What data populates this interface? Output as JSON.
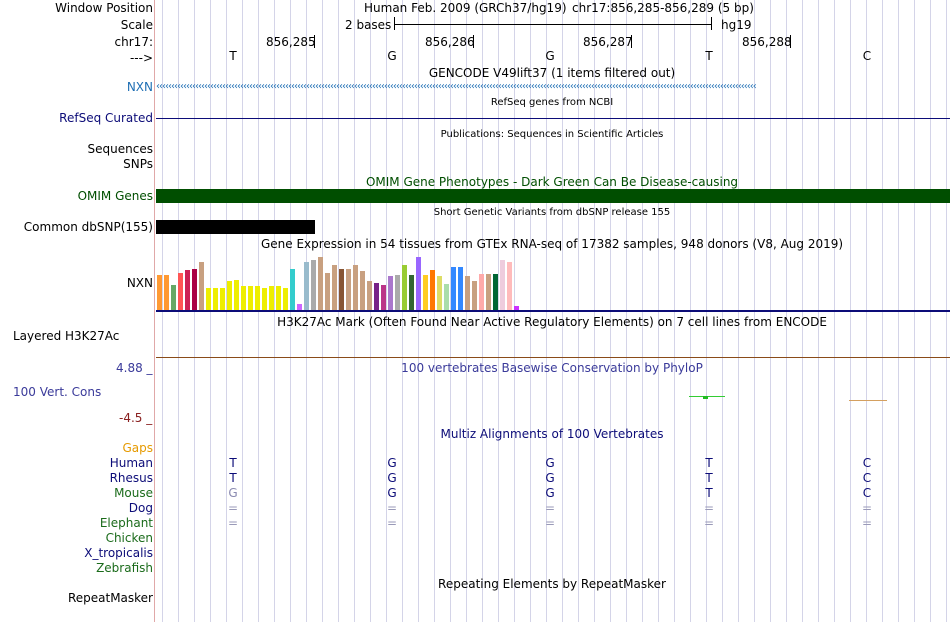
{
  "header": {
    "window_position_label": "Window Position",
    "scale_label": "Scale",
    "chr_label": "chr17:",
    "strand_label": "--->",
    "assembly_text": "Human Feb. 2009 (GRCh37/hg19)",
    "position_text": "chr17:856,285-856,289 (5 bp)",
    "scale_text": "2 bases",
    "db_text": "hg19",
    "coordinates": [
      "856,285",
      "856,286",
      "856,287",
      "856,288"
    ],
    "bases": [
      "T",
      "G",
      "G",
      "T",
      "C"
    ]
  },
  "tracks": {
    "gencode": {
      "title": "GENCODE V49lift37 (1 items filtered out)",
      "label": "NXN",
      "color": "#1f6fb4"
    },
    "refseq": {
      "title": "RefSeq genes from NCBI",
      "label": "RefSeq Curated",
      "color": "#0c0c78"
    },
    "publications": {
      "title": "Publications: Sequences in Scientific Articles",
      "label_sequences": "Sequences",
      "label_snps": "SNPs"
    },
    "omim": {
      "title": "OMIM Gene Phenotypes - Dark Green Can Be Disease-causing",
      "label": "OMIM Genes",
      "color": "#004e00"
    },
    "dbsnp": {
      "title": "Short Genetic Variants from dbSNP release 155",
      "label": "Common dbSNP(155)"
    },
    "gtex": {
      "title": "Gene Expression in 54 tissues from GTEx RNA-seq of 17382 samples, 948 donors (V8, Aug 2019)",
      "label": "NXN",
      "bars": [
        {
          "h": 0.62,
          "c": "#ff9933"
        },
        {
          "h": 0.62,
          "c": "#ff9933"
        },
        {
          "h": 0.44,
          "c": "#66a866"
        },
        {
          "h": 0.66,
          "c": "#ff5555"
        },
        {
          "h": 0.72,
          "c": "#cc2255"
        },
        {
          "h": 0.74,
          "c": "#aa0044"
        },
        {
          "h": 0.85,
          "c": "#c8a080"
        },
        {
          "h": 0.4,
          "c": "#eeee00"
        },
        {
          "h": 0.4,
          "c": "#eeee00"
        },
        {
          "h": 0.4,
          "c": "#eeee00"
        },
        {
          "h": 0.52,
          "c": "#eeee00"
        },
        {
          "h": 0.54,
          "c": "#eeee00"
        },
        {
          "h": 0.43,
          "c": "#eeee00"
        },
        {
          "h": 0.43,
          "c": "#eeee00"
        },
        {
          "h": 0.43,
          "c": "#eeee00"
        },
        {
          "h": 0.4,
          "c": "#eeee00"
        },
        {
          "h": 0.43,
          "c": "#eeee00"
        },
        {
          "h": 0.43,
          "c": "#eeee00"
        },
        {
          "h": 0.4,
          "c": "#eeee00"
        },
        {
          "h": 0.74,
          "c": "#33cccc"
        },
        {
          "h": 0.1,
          "c": "#cc66ff"
        },
        {
          "h": 0.85,
          "c": "#99bbcc"
        },
        {
          "h": 0.9,
          "c": "#aaaaaa"
        },
        {
          "h": 0.95,
          "c": "#c8a080"
        },
        {
          "h": 0.66,
          "c": "#c8a080"
        },
        {
          "h": 0.8,
          "c": "#c8a080"
        },
        {
          "h": 0.74,
          "c": "#885533"
        },
        {
          "h": 0.74,
          "c": "#c8a080"
        },
        {
          "h": 0.8,
          "c": "#c8a080"
        },
        {
          "h": 0.7,
          "c": "#c8a080"
        },
        {
          "h": 0.52,
          "c": "#c8a080"
        },
        {
          "h": 0.48,
          "c": "#772288"
        },
        {
          "h": 0.44,
          "c": "#bb3388"
        },
        {
          "h": 0.6,
          "c": "#aa77cc"
        },
        {
          "h": 0.62,
          "c": "#aaaaaa"
        },
        {
          "h": 0.8,
          "c": "#99cc33"
        },
        {
          "h": 0.63,
          "c": "#336633"
        },
        {
          "h": 0.95,
          "c": "#9966ff"
        },
        {
          "h": 0.63,
          "c": "#ffcc22"
        },
        {
          "h": 0.72,
          "c": "#ff7700"
        },
        {
          "h": 0.6,
          "c": "#dddd66"
        },
        {
          "h": 0.46,
          "c": "#aaddaa"
        },
        {
          "h": 0.76,
          "c": "#3388ff"
        },
        {
          "h": 0.76,
          "c": "#3388ff"
        },
        {
          "h": 0.6,
          "c": "#c8a080"
        },
        {
          "h": 0.51,
          "c": "#c8a080"
        },
        {
          "h": 0.64,
          "c": "#ffaaaa"
        },
        {
          "h": 0.64,
          "c": "#c8a080"
        },
        {
          "h": 0.65,
          "c": "#006633"
        },
        {
          "h": 0.9,
          "c": "#eeccdd"
        },
        {
          "h": 0.86,
          "c": "#ffbbbb"
        },
        {
          "h": 0.07,
          "c": "#cc33ff"
        }
      ]
    },
    "h3k27ac": {
      "title": "H3K27Ac Mark (Often Found Near Active Regulatory Elements) on 7 cell lines from ENCODE",
      "label": "Layered H3K27Ac"
    },
    "phylop": {
      "title": "100 vertebrates Basewise Conservation by PhyloP",
      "label": "100 Vert. Cons",
      "max": "4.88 _",
      "min": "-4.5 _"
    },
    "multiz": {
      "title": "Multiz Alignments of 100 Vertebrates",
      "gaps_label": "Gaps",
      "species": [
        {
          "name": "Human",
          "color": "#0c0c78",
          "seq": [
            "T",
            "G",
            "G",
            "T",
            "C"
          ]
        },
        {
          "name": "Rhesus",
          "color": "#0c0c78",
          "seq": [
            "T",
            "G",
            "G",
            "T",
            "C"
          ]
        },
        {
          "name": "Mouse",
          "color": "#1b6b1b",
          "seq": [
            "G",
            "G",
            "G",
            "T",
            "C"
          ]
        },
        {
          "name": "Dog",
          "color": "#0c0c78",
          "seq": [
            "=",
            "=",
            "=",
            "=",
            "="
          ]
        },
        {
          "name": "Elephant",
          "color": "#1b6b1b",
          "seq": [
            "=",
            "=",
            "=",
            "=",
            "="
          ]
        },
        {
          "name": "Chicken",
          "color": "#1b6b1b",
          "seq": [
            "",
            "",
            "",
            "",
            ""
          ]
        },
        {
          "name": "X_tropicalis",
          "color": "#0c0c78",
          "seq": [
            "",
            "",
            "",
            "",
            ""
          ]
        },
        {
          "name": "Zebrafish",
          "color": "#1b6b1b",
          "seq": [
            "",
            "",
            "",
            "",
            ""
          ]
        }
      ]
    },
    "repeatmasker": {
      "title": "Repeating Elements by RepeatMasker",
      "label": "RepeatMasker"
    }
  }
}
